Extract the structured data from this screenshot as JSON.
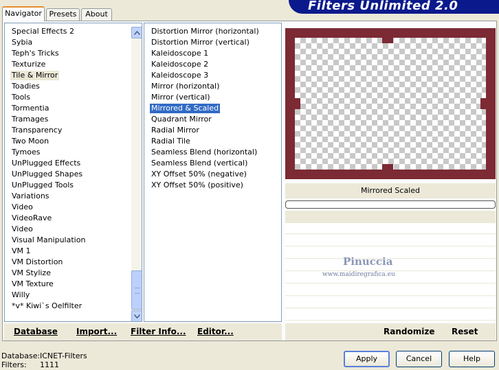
{
  "tabs": {
    "navigator": "Navigator",
    "presets": "Presets",
    "about": "About"
  },
  "banner": {
    "title": "Filters Unlimited 2.0"
  },
  "categories": [
    "Special Effects 2",
    "Sybia",
    "Teph's Tricks",
    "Texturize",
    "Tile & Mirror",
    "Toadies",
    "Tools",
    "Tormentia",
    "Tramages",
    "Transparency",
    "Two Moon",
    "Tymoes",
    "UnPlugged Effects",
    "UnPlugged Shapes",
    "UnPlugged Tools",
    "Variations",
    "Video",
    "VideoRave",
    "Video",
    "Visual Manipulation",
    "VM 1",
    "VM Distortion",
    "VM Stylize",
    "VM Texture",
    "Willy",
    "*v* Kiwi`s Oelfilter"
  ],
  "filters": [
    "Distortion Mirror (horizontal)",
    "Distortion Mirror (vertical)",
    "Kaleidoscope 1",
    "Kaleidoscope 2",
    "Kaleidoscope 3",
    "Mirror (horizontal)",
    "Mirror (vertical)",
    "Mirrored & Scaled",
    "Quadrant Mirror",
    "Radial Mirror",
    "Radial Tile",
    "Seamless Blend (horizontal)",
    "Seamless Blend (vertical)",
    "XY Offset 50% (negative)",
    "XY Offset 50% (positive)"
  ],
  "selected_category": "Tile & Mirror",
  "selected_filter": "Mirrored & Scaled",
  "preview": {
    "filter_name": "Mirrored  Scaled",
    "progress": 0
  },
  "watermark": {
    "name": "Pinuccia",
    "site": "www.maidiregrafica.eu"
  },
  "bottom_buttons": {
    "database": "Database",
    "import": "Import...",
    "filter_info": "Filter Info...",
    "editor": "Editor...",
    "randomize": "Randomize",
    "reset": "Reset"
  },
  "status": {
    "database_label": "Database:",
    "database_value": "ICNET-Filters",
    "filters_label": "Filters:",
    "filters_value": "1111"
  },
  "dialog_buttons": {
    "apply": "Apply",
    "cancel": "Cancel",
    "help": "Help"
  },
  "colors": {
    "banner": "#0a1a8c",
    "frame": "#7c2a34",
    "selection": "#316ac5"
  }
}
